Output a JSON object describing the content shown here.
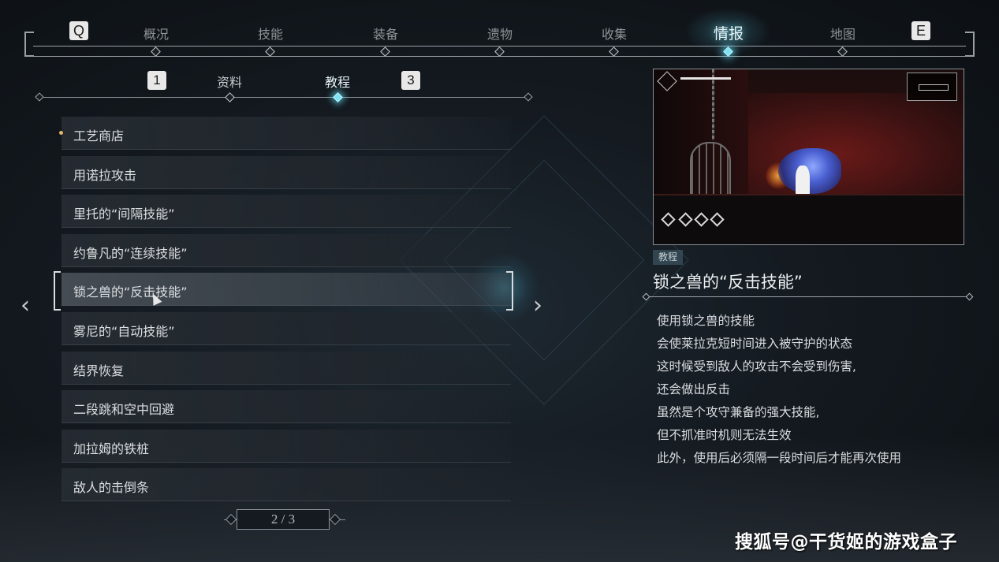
{
  "top_nav": {
    "left_key": "Q",
    "right_key": "E",
    "tabs": [
      {
        "label": "概况"
      },
      {
        "label": "技能"
      },
      {
        "label": "装备"
      },
      {
        "label": "遗物"
      },
      {
        "label": "收集"
      },
      {
        "label": "情报"
      },
      {
        "label": "地图"
      }
    ],
    "active_tab": "情报"
  },
  "sub_nav": {
    "left_key": "1",
    "right_key": "3",
    "tabs": [
      {
        "label": "资料"
      },
      {
        "label": "教程"
      }
    ],
    "active_tab": "教程"
  },
  "tutorial_list": {
    "items": [
      {
        "label": "工艺商店",
        "new": true
      },
      {
        "label": "用诺拉攻击"
      },
      {
        "label": "里托的“间隔技能”"
      },
      {
        "label": "约鲁凡的“连续技能”"
      },
      {
        "label": "锁之兽的“反击技能”",
        "selected": true
      },
      {
        "label": "雾尼的“自动技能”"
      },
      {
        "label": "结界恢复"
      },
      {
        "label": "二段跳和空中回避"
      },
      {
        "label": "加拉姆的铁桩"
      },
      {
        "label": "敌人的击倒条"
      }
    ],
    "pager": "2 / 3"
  },
  "detail": {
    "tag": "教程",
    "title": "锁之兽的“反击技能”",
    "lines": [
      "使用锁之兽的技能",
      "会使莱拉克短时间进入被守护的状态",
      "这时候受到敌人的攻击不会受到伤害,",
      "还会做出反击",
      "虽然是个攻守兼备的强大技能,",
      "但不抓准时机则无法生效",
      "此外，使用后必须隔一段时间后才能再次使用"
    ]
  },
  "watermark": "搜狐号@干货姬的游戏盒子",
  "colors": {
    "accent": "#7fe3f5",
    "new_marker": "#e4b56a"
  }
}
